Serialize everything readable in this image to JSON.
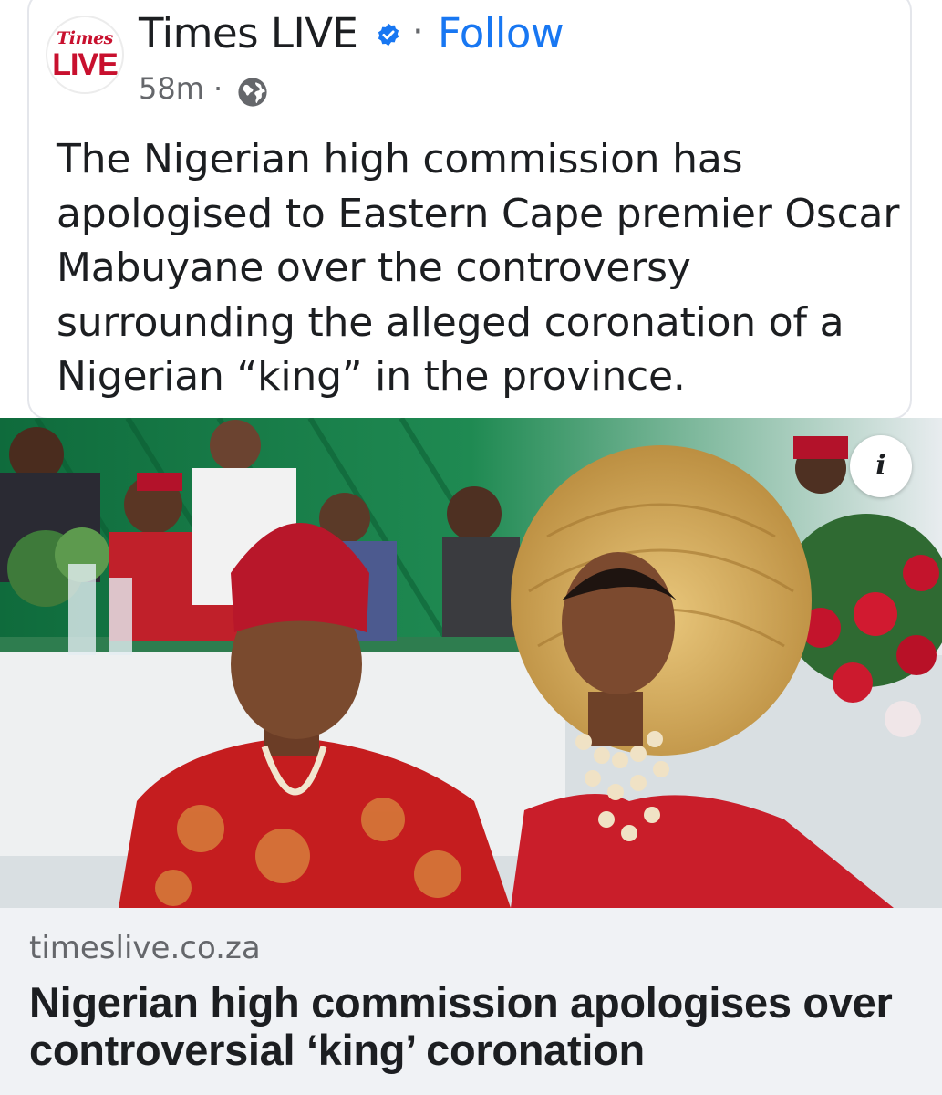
{
  "post": {
    "author": "Times LIVE",
    "follow_label": "Follow",
    "separator": "·",
    "timestamp": "58m",
    "text": "The Nigerian high commission has apologised to Eastern Cape premier Oscar Mabuyane over the controversy surrounding the alleged coronation of a Nigerian “king” in the province.",
    "logo": {
      "line1": "Times",
      "line2": "LIVE"
    },
    "icons": {
      "verified": "verified-badge-icon",
      "audience": "globe-icon",
      "info": "info-icon"
    }
  },
  "photo": {
    "info_label": "i"
  },
  "link": {
    "domain": "timeslive.co.za",
    "headline": "Nigerian high commission apologises over controversial ‘king’ coronation"
  },
  "colors": {
    "accent": "#1877f2",
    "brand_red": "#c8102e",
    "muted_text": "#65676b",
    "preview_bg": "#f0f2f5"
  }
}
